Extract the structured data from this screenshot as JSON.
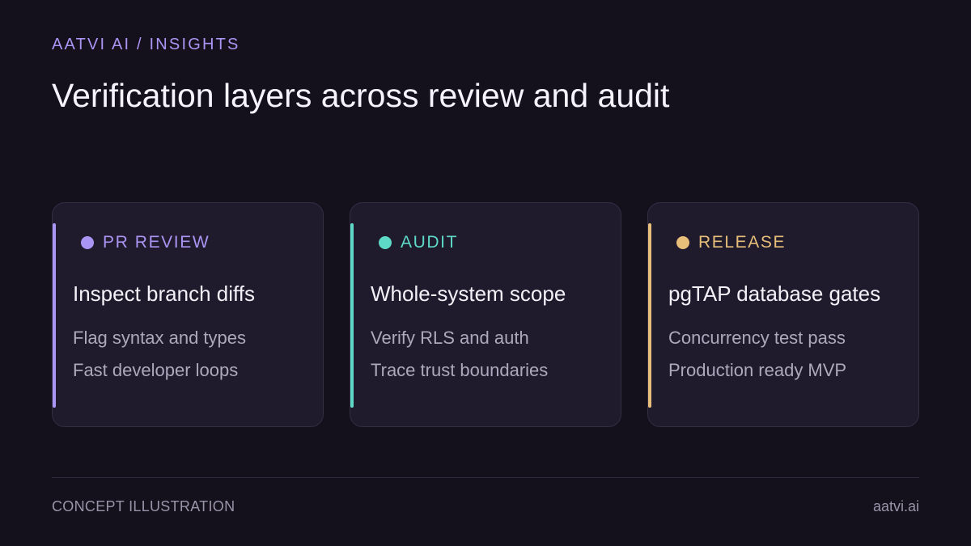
{
  "header": {
    "eyebrow": "AATVI AI / INSIGHTS",
    "title": "Verification layers across review and audit"
  },
  "cards": [
    {
      "tag": "PR REVIEW",
      "heading": "Inspect branch diffs",
      "lines": [
        "Flag syntax and types",
        "Fast developer loops"
      ],
      "accent": "#a995f3"
    },
    {
      "tag": "AUDIT",
      "heading": "Whole-system scope",
      "lines": [
        "Verify RLS and auth",
        "Trace trust boundaries"
      ],
      "accent": "#5ed9c8"
    },
    {
      "tag": "RELEASE",
      "heading": "pgTAP database gates",
      "lines": [
        "Concurrency test pass",
        "Production ready MVP"
      ],
      "accent": "#e8bf7a"
    }
  ],
  "footer": {
    "left": "CONCEPT ILLUSTRATION",
    "right": "aatvi.ai"
  },
  "colors": {
    "background": "#14111d",
    "card_background": "#1f1b2c",
    "card_border": "#332e42",
    "eyebrow": "#a995f3"
  }
}
